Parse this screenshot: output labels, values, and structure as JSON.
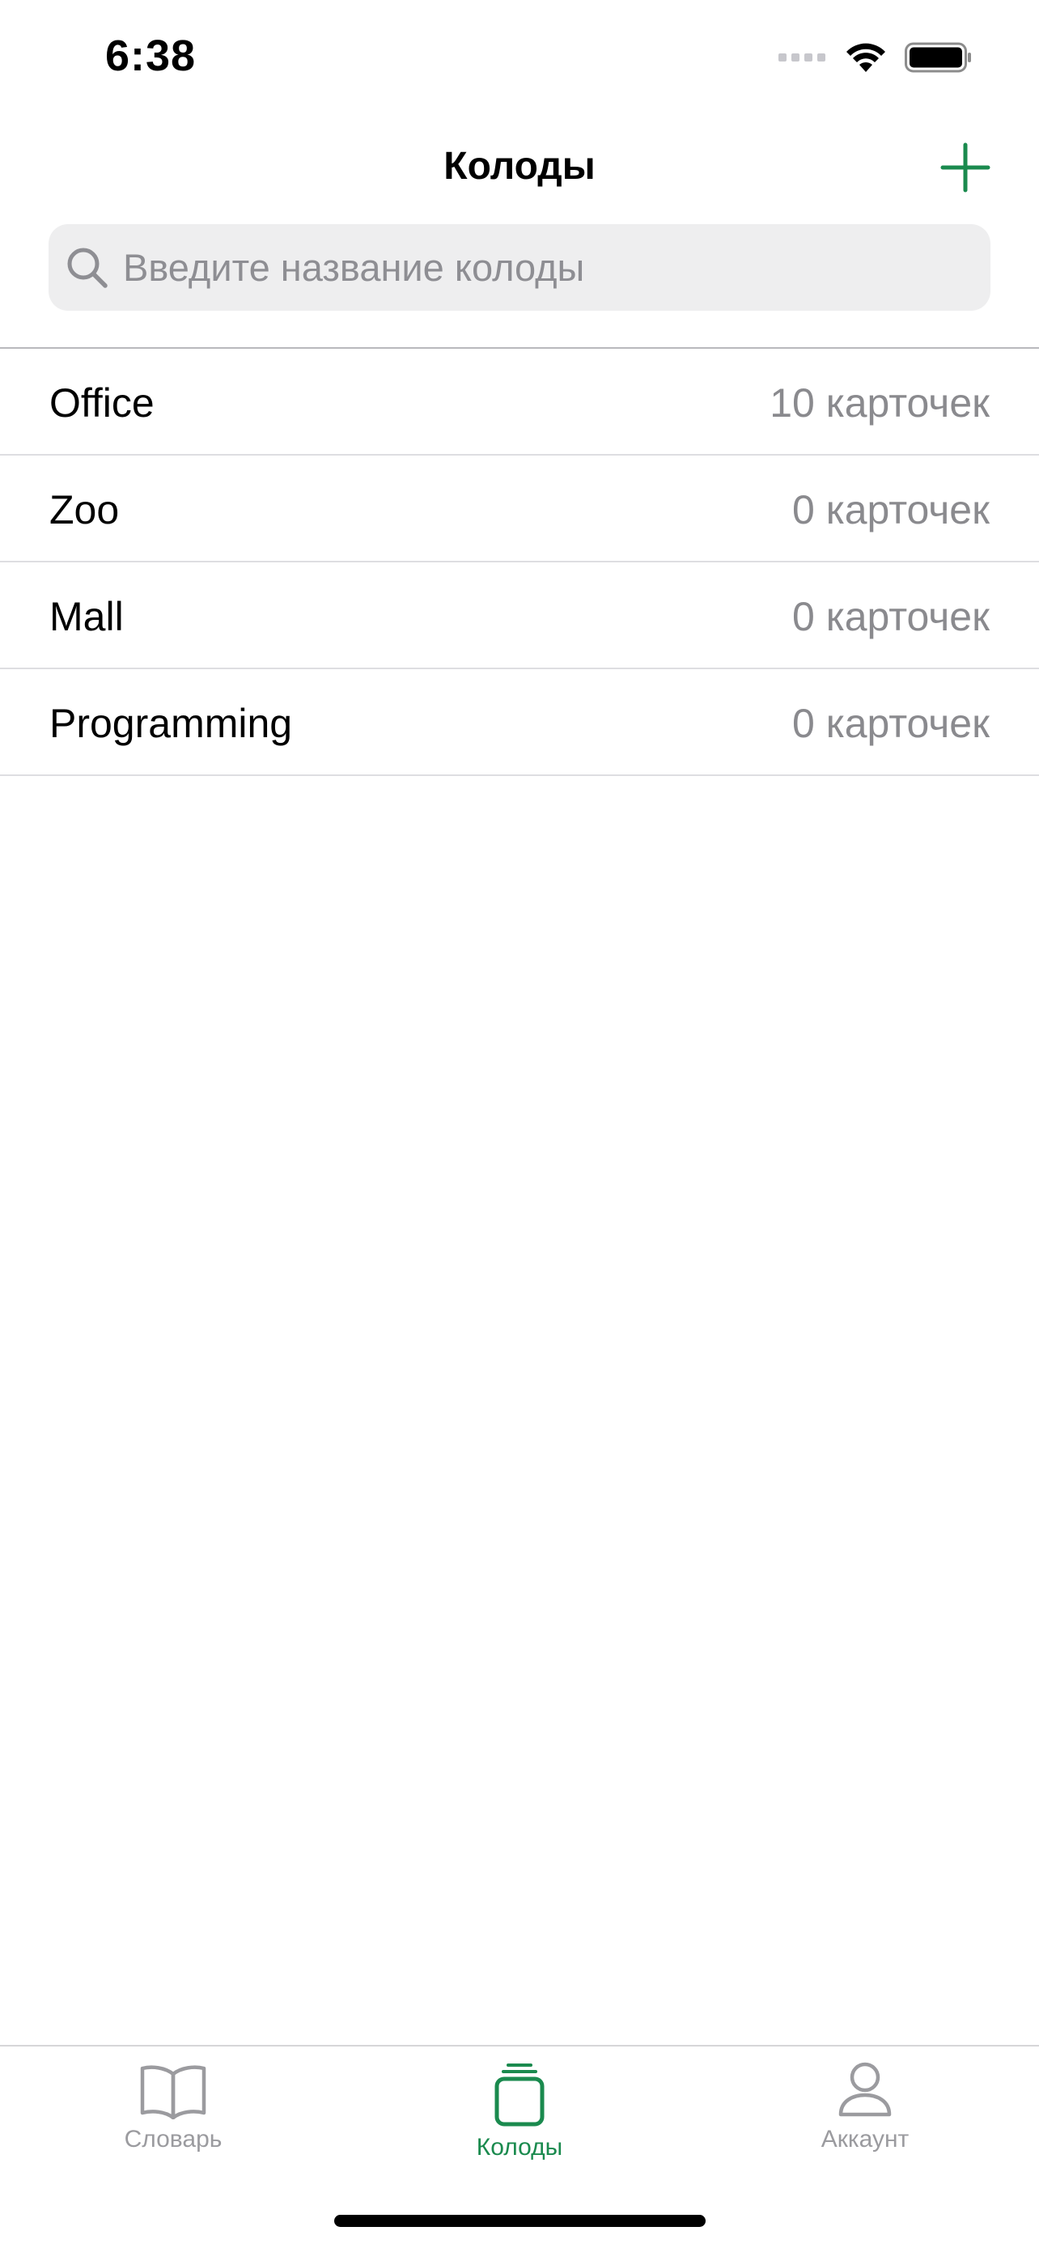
{
  "status_bar": {
    "time": "6:38"
  },
  "nav": {
    "title": "Колоды",
    "add_icon": "plus-icon"
  },
  "search": {
    "placeholder": "Введите название колоды",
    "value": ""
  },
  "decks": [
    {
      "name": "Office",
      "count": "10 карточек"
    },
    {
      "name": "Zoo",
      "count": "0 карточек"
    },
    {
      "name": "Mall",
      "count": "0 карточек"
    },
    {
      "name": "Programming",
      "count": "0 карточек"
    }
  ],
  "tab_bar": {
    "items": [
      {
        "label": "Словарь",
        "icon": "book-icon",
        "active": false
      },
      {
        "label": "Колоды",
        "icon": "card-stack-icon",
        "active": true
      },
      {
        "label": "Аккаунт",
        "icon": "person-icon",
        "active": false
      }
    ]
  },
  "colors": {
    "accent": "#1a8a4e",
    "secondary_text": "#8a8a8e",
    "search_background": "#eeeeef"
  }
}
